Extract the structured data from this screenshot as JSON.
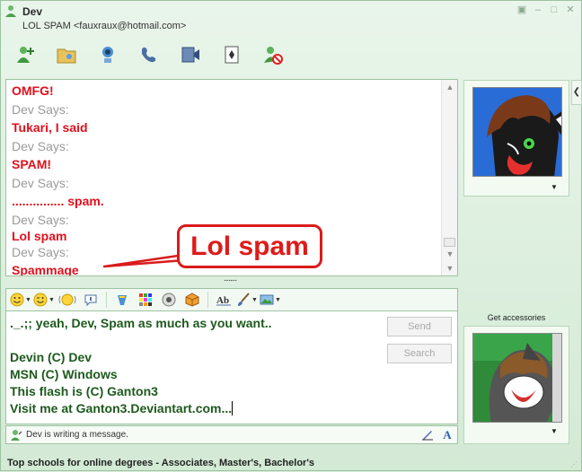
{
  "window": {
    "title": "Dev",
    "subtitle": "LOL SPAM <fauxraux@hotmail.com>"
  },
  "toolbar": {
    "icons": [
      "invite-contact-icon",
      "send-files-icon",
      "webcam-icon",
      "call-icon",
      "video-icon",
      "games-icon",
      "block-icon"
    ]
  },
  "conversation": {
    "messages": [
      {
        "says": "",
        "text": "OMFG!"
      },
      {
        "says": "Dev Says:",
        "text": "Tukari, I said"
      },
      {
        "says": "Dev Says:",
        "text": "SPAM!"
      },
      {
        "says": "Dev Says:",
        "text": "............... spam."
      },
      {
        "says": "Dev Says:",
        "text": "Lol spam"
      },
      {
        "says": "Dev Says:",
        "text": "Spammage"
      }
    ],
    "splitter": "........"
  },
  "callout": {
    "text": "Lol spam"
  },
  "input": {
    "lines": [
      "._.;; yeah, Dev, Spam as much as you want..",
      "",
      "Devin (C) Dev",
      "MSN (C) Windows",
      "This flash is (C) Ganton3",
      "Visit me at Ganton3.Deviantart.com..."
    ],
    "send_label": "Send",
    "search_label": "Search"
  },
  "status": {
    "text": "Dev is writing a message."
  },
  "ad": {
    "text": "Top schools for online degrees - Associates, Master's, Bachelor's"
  },
  "sidebar": {
    "get_accessories": "Get accessories"
  },
  "colors": {
    "message_red": "#e0101c",
    "says_gray": "#9a9a9a",
    "input_green": "#1d5a1d",
    "window_bg": "#d8ecd9"
  }
}
